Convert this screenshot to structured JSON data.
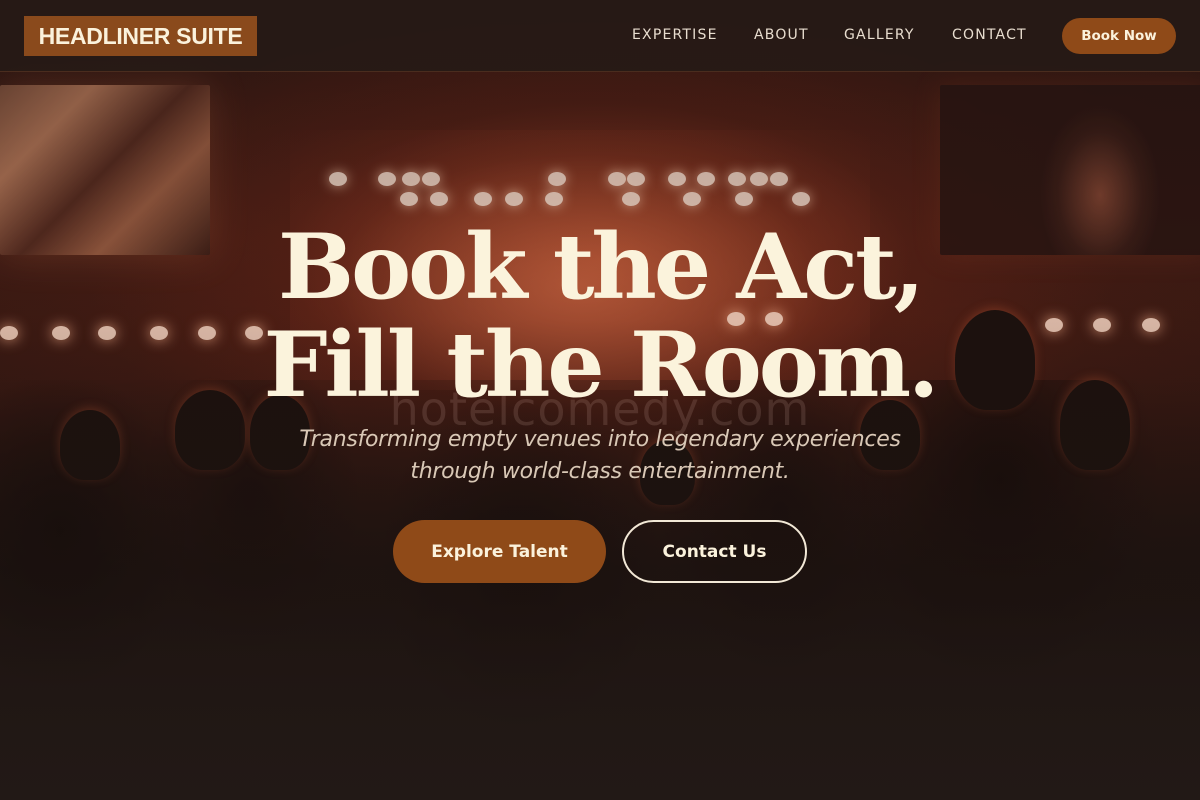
{
  "brand": {
    "logo_text": "HEADLINER SUITE",
    "accent_color": "#8f4a18",
    "text_color": "#fbf3dc"
  },
  "nav": {
    "links": [
      {
        "label": "EXPERTISE"
      },
      {
        "label": "ABOUT"
      },
      {
        "label": "GALLERY"
      },
      {
        "label": "CONTACT"
      }
    ],
    "cta_label": "Book Now"
  },
  "hero": {
    "headline_line1": "Book the Act,",
    "headline_line2": "Fill the Room.",
    "subtitle_line1": "Transforming empty venues into legendary experiences",
    "subtitle_line2": "through world-class entertainment.",
    "primary_button": "Explore Talent",
    "secondary_button": "Contact Us",
    "watermark_text": "hotelcomedy.com",
    "background_image": "concert-crowd-stage"
  }
}
